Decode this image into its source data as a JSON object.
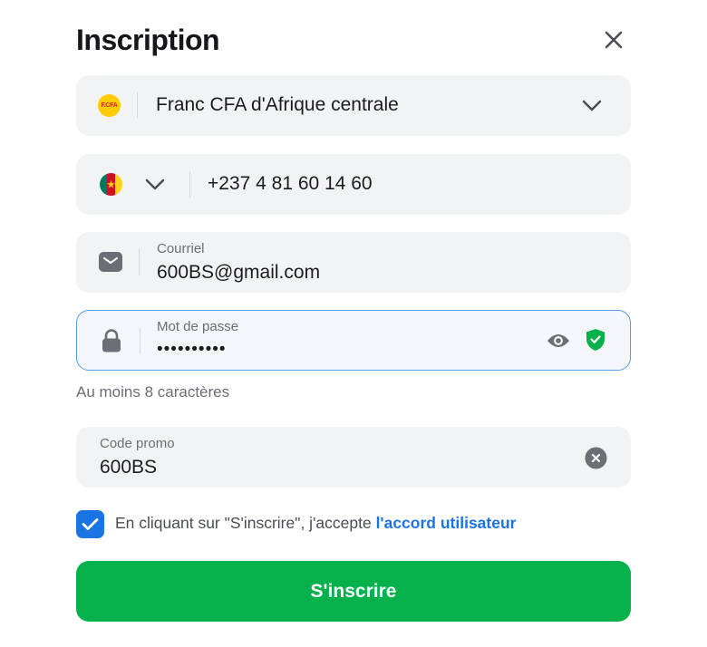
{
  "header": {
    "title": "Inscription"
  },
  "currency": {
    "badge": "F.CFA",
    "value": "Franc CFA d'Afrique centrale"
  },
  "phone": {
    "value": "+237 4 81 60 14 60",
    "flag_colors": [
      "#007a5e",
      "#ce1126",
      "#fcd116"
    ]
  },
  "email": {
    "label": "Courriel",
    "value": "600BS@gmail.com"
  },
  "password": {
    "label": "Mot de passe",
    "masked_value": "••••••••••",
    "hint": "Au moins 8 caractères"
  },
  "promo": {
    "label": "Code promo",
    "value": "600BS"
  },
  "terms": {
    "checked": true,
    "text": "En cliquant sur \"S'inscrire\", j'accepte ",
    "link": "l'accord utilisateur"
  },
  "submit": {
    "label": "S'inscrire"
  },
  "colors": {
    "accent": "#1b74e4",
    "success": "#04b14a",
    "focus_border": "#5b9be6",
    "field_bg": "#f2f3f5"
  }
}
